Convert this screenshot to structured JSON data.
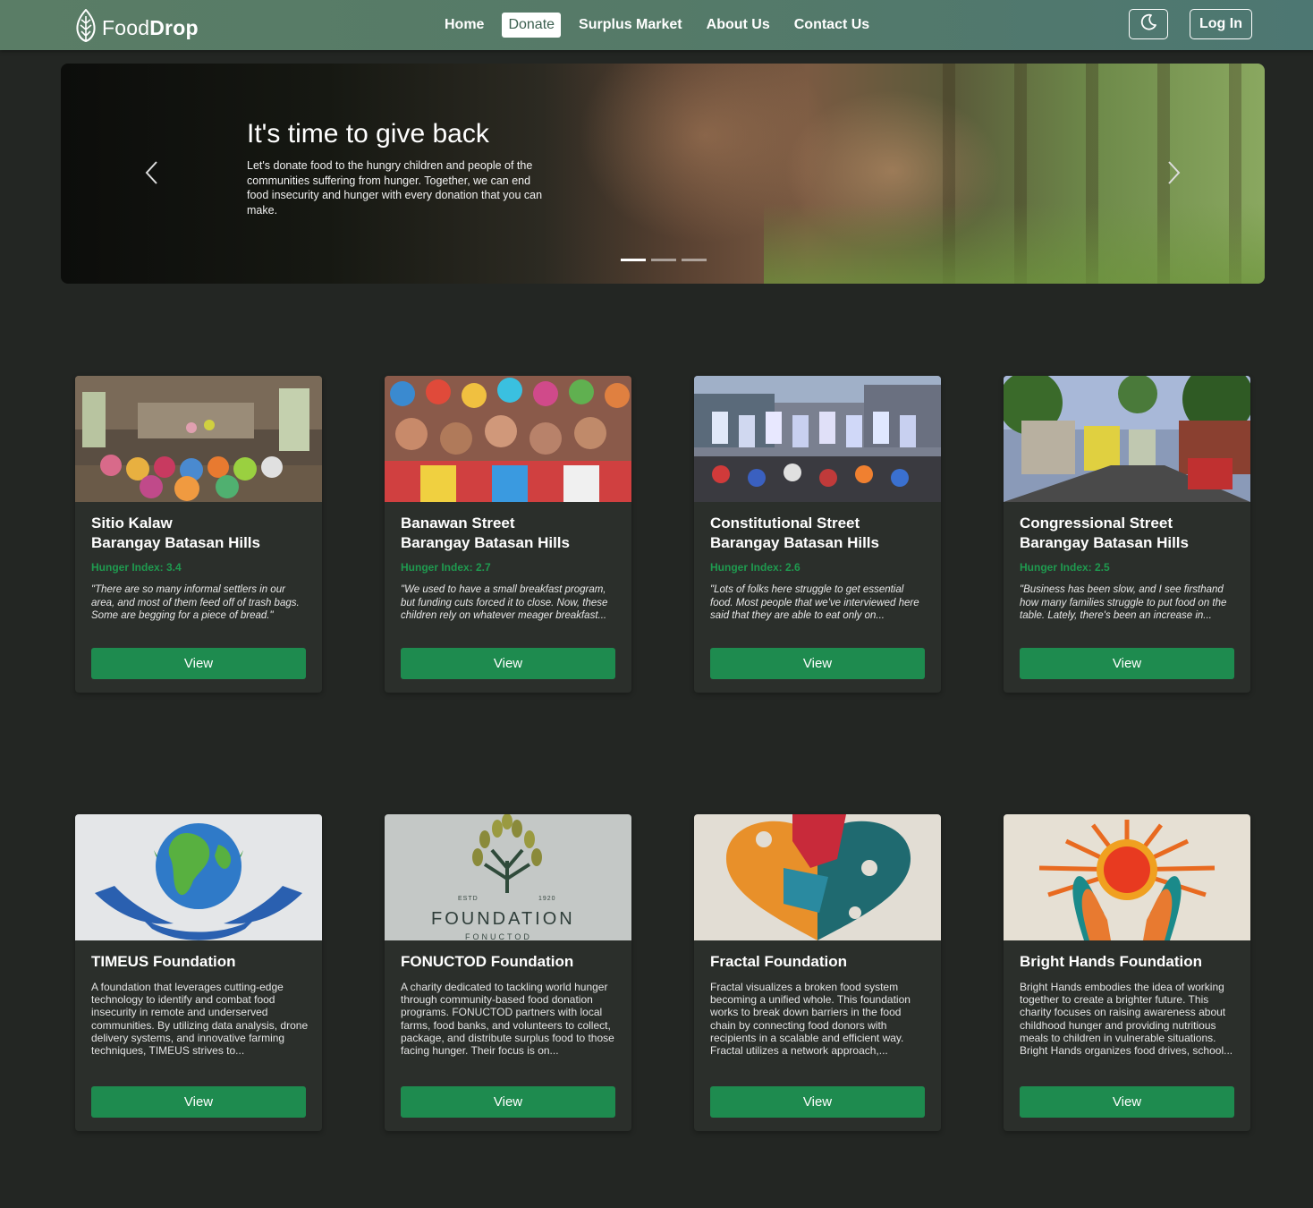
{
  "navbar": {
    "brand_plain": "Food",
    "brand_bold": "Drop",
    "links": [
      {
        "label": "Home",
        "active": false
      },
      {
        "label": "Donate",
        "active": true
      },
      {
        "label": "Surplus Market",
        "active": false
      },
      {
        "label": "About Us",
        "active": false
      },
      {
        "label": "Contact Us",
        "active": false
      }
    ],
    "theme_icon": "moon-icon",
    "login_label": "Log In"
  },
  "hero": {
    "title": "It's time to give back",
    "text": "Let's donate food to the hungry children and people of the communities suffering from hunger. Together, we can end food insecurity and hunger with every donation that you can make.",
    "slides": 3,
    "active_slide": 0
  },
  "communities": [
    {
      "line1": "Sitio Kalaw",
      "line2": "Barangay Batasan Hills",
      "hunger": "Hunger Index: 3.4",
      "quote": "\"There are so many informal settlers in our area, and most of them feed off of trash bags. Some are begging for a piece of bread.\"",
      "button": "View"
    },
    {
      "line1": "Banawan Street",
      "line2": "Barangay Batasan Hills",
      "hunger": "Hunger Index: 2.7",
      "quote": "\"We used to have a small breakfast program, but funding cuts forced it to close. Now, these children rely on whatever meager breakfast...",
      "button": "View"
    },
    {
      "line1": "Constitutional Street",
      "line2": "Barangay Batasan Hills",
      "hunger": "Hunger Index: 2.6",
      "quote": "\"Lots of folks here struggle to get essential food. Most people that we've interviewed here said that they are able to eat only on...",
      "button": "View"
    },
    {
      "line1": "Congressional Street",
      "line2": "Barangay Batasan Hills",
      "hunger": "Hunger Index: 2.5",
      "quote": "\"Business has been slow, and I see firsthand how many families struggle to put food on the table. Lately, there's been an increase in...",
      "button": "View"
    }
  ],
  "foundations": [
    {
      "name": "TIMEUS Foundation",
      "desc": "A foundation that leverages cutting-edge technology to identify and combat food insecurity in remote and underserved communities. By utilizing data analysis, drone delivery systems, and innovative farming techniques, TIMEUS strives to...",
      "button": "View"
    },
    {
      "name": "FONUCTOD Foundation",
      "desc": "A charity dedicated to tackling world hunger through community-based food donation programs. FONUCTOD partners with local farms, food banks, and volunteers to collect, package, and distribute surplus food to those facing hunger. Their focus is on...",
      "button": "View",
      "logo_estd": "ESTD",
      "logo_year": "1920",
      "logo_word": "FOUNDATION",
      "logo_sub": "FONUCTOD"
    },
    {
      "name": "Fractal Foundation",
      "desc": "Fractal visualizes a broken food system becoming a unified whole. This foundation works to break down barriers in the food chain by connecting food donors with recipients in a scalable and efficient way. Fractal utilizes a network approach,...",
      "button": "View"
    },
    {
      "name": "Bright Hands Foundation",
      "desc": "Bright Hands embodies the idea of working together to create a brighter future. This charity focuses on raising awareness about childhood hunger and providing nutritious meals to children in vulnerable situations. Bright Hands organizes food drives, school...",
      "button": "View"
    }
  ],
  "colors": {
    "accent_green": "#1e8b4f",
    "hunger_green": "#1f9a4f",
    "page_bg": "#232623",
    "card_bg": "#2b2f2b"
  }
}
